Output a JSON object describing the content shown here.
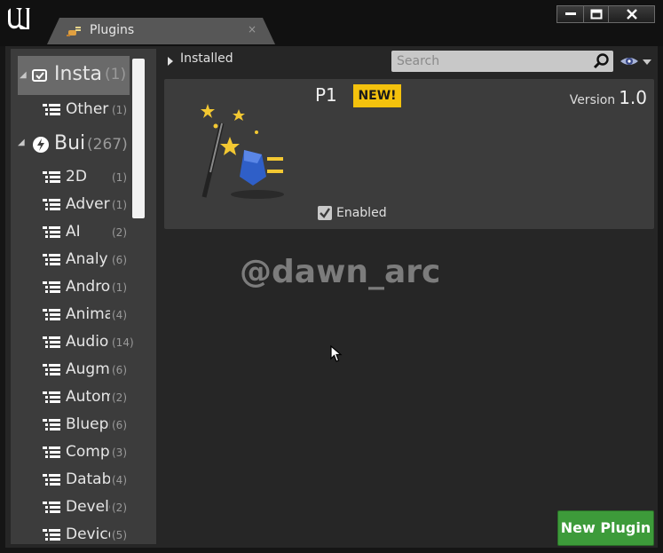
{
  "window": {
    "tab_title": "Plugins",
    "tab_close": "×"
  },
  "sidebar": {
    "categories": [
      {
        "name": "Installed",
        "label": "Insta",
        "count": "(1)",
        "selected": true,
        "icon": "installed-icon",
        "subcategories": [
          {
            "label": "Other",
            "count": "(1)"
          }
        ]
      },
      {
        "name": "Built-In",
        "label": "Bui",
        "count": "(267)",
        "icon": "built-in-icon",
        "subcategories": [
          {
            "label": "2D",
            "count": "(1)"
          },
          {
            "label": "Adver",
            "count": "(1)"
          },
          {
            "label": "AI",
            "count": "(2)"
          },
          {
            "label": "Analy",
            "count": "(6)"
          },
          {
            "label": "Andro",
            "count": "(1)"
          },
          {
            "label": "Anima",
            "count": "(4)"
          },
          {
            "label": "Audio",
            "count": "(14)"
          },
          {
            "label": "Augm",
            "count": "(6)"
          },
          {
            "label": "Autom",
            "count": "(2)"
          },
          {
            "label": "Bluepr",
            "count": "(6)"
          },
          {
            "label": "Comp",
            "count": "(3)"
          },
          {
            "label": "Datab",
            "count": "(4)"
          },
          {
            "label": "Develo",
            "count": "(2)"
          },
          {
            "label": "Device",
            "count": "(5)"
          }
        ]
      }
    ]
  },
  "header": {
    "breadcrumb": "Installed",
    "search_placeholder": "Search"
  },
  "plugin": {
    "name": "P1",
    "badge": "NEW!",
    "version_label": "Version",
    "version": "1.0",
    "enabled_label": "Enabled",
    "enabled": true
  },
  "watermark": "@dawn_arc",
  "footer": {
    "new_plugin_label": "New Plugin"
  },
  "colors": {
    "badge": "#f4c20d",
    "new_plugin_button": "#3d9b3a",
    "selected_category": "#6a6a6a"
  }
}
